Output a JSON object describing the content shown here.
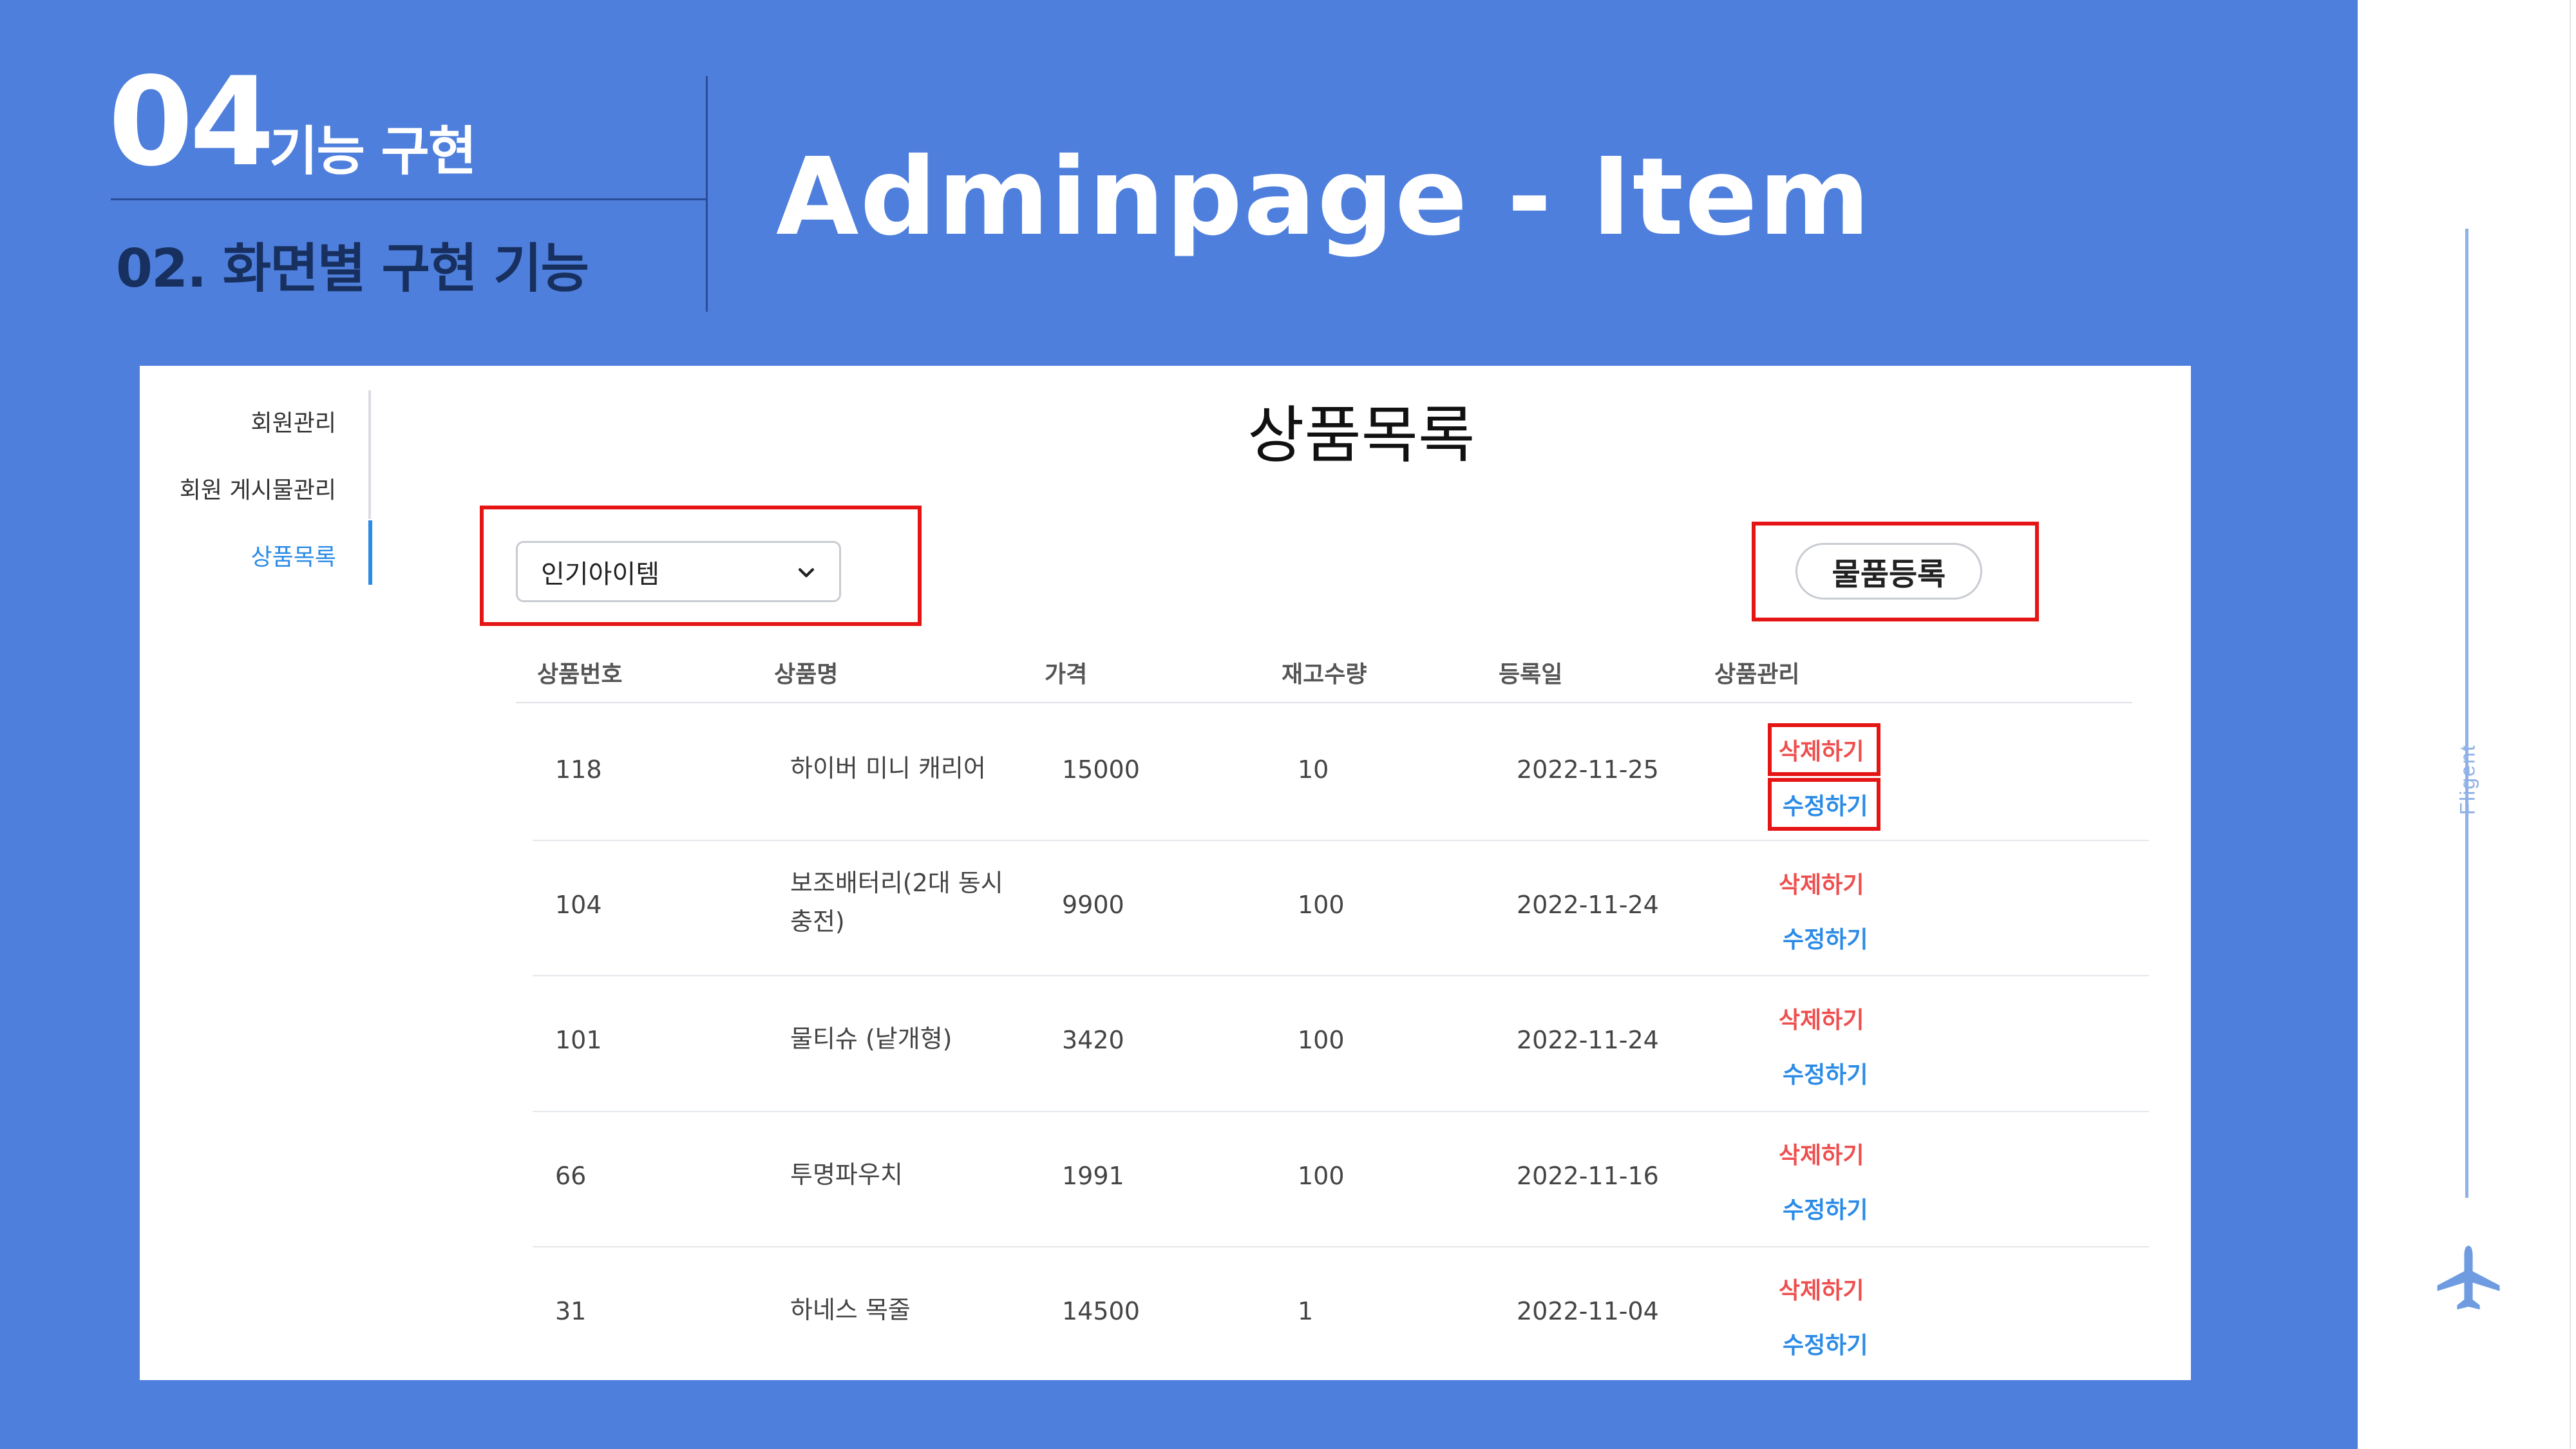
{
  "slide": {
    "section_number": "04",
    "section_title": "기능 구현",
    "subsection": "02. 화면별 구현 기능",
    "title": "Adminpage - Item",
    "brand": "Fligent"
  },
  "colors": {
    "slide_background": "#4f7fdc",
    "highlight_box": "#e61515",
    "delete_text": "#ef4e4e",
    "edit_text": "#2b8be6"
  },
  "admin": {
    "sidebar": {
      "items": [
        {
          "label": "회원관리",
          "active": false
        },
        {
          "label": "회원 게시물관리",
          "active": false
        },
        {
          "label": "상품목록",
          "active": true
        }
      ]
    },
    "page_title": "상품목록",
    "filter_select": {
      "value": "인기아이템"
    },
    "register_button": "물품등록",
    "table": {
      "headers": [
        "상품번호",
        "상품명",
        "가격",
        "재고수량",
        "등록일",
        "상품관리"
      ],
      "rows": [
        {
          "id": "118",
          "name": "하이버 미니 캐리어",
          "price": "15000",
          "stock": "10",
          "date": "2022-11-25",
          "delete": "삭제하기",
          "edit": "수정하기"
        },
        {
          "id": "104",
          "name": "보조배터리(2대 동시 충전)",
          "price": "9900",
          "stock": "100",
          "date": "2022-11-24",
          "delete": "삭제하기",
          "edit": "수정하기"
        },
        {
          "id": "101",
          "name": "물티슈 (낱개형)",
          "price": "3420",
          "stock": "100",
          "date": "2022-11-24",
          "delete": "삭제하기",
          "edit": "수정하기"
        },
        {
          "id": "66",
          "name": "투명파우치",
          "price": "1991",
          "stock": "100",
          "date": "2022-11-16",
          "delete": "삭제하기",
          "edit": "수정하기"
        },
        {
          "id": "31",
          "name": "하네스 목줄",
          "price": "14500",
          "stock": "1",
          "date": "2022-11-04",
          "delete": "삭제하기",
          "edit": "수정하기"
        }
      ]
    }
  }
}
